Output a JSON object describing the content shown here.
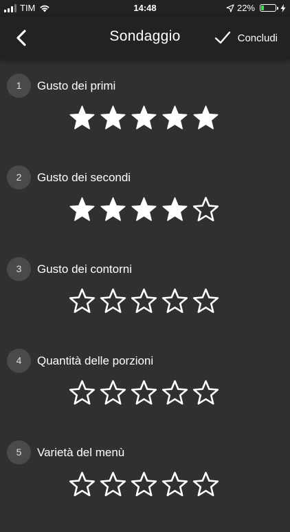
{
  "status_bar": {
    "carrier": "TIM",
    "time": "14:48",
    "battery_percent": "22%",
    "battery_level": 0.22,
    "signal_bars": 3,
    "icons": [
      "signal-icon",
      "wifi-icon",
      "location-arrow-icon",
      "battery-icon",
      "charging-bolt-icon"
    ]
  },
  "nav": {
    "title": "Sondaggio",
    "back_icon": "chevron-left-icon",
    "done_icon": "checkmark-icon",
    "done_label": "Concludi"
  },
  "colors": {
    "background": "#303030",
    "bar": "#222222",
    "badge": "#4a4a4a",
    "text": "#ffffff"
  },
  "max_rating": 5,
  "questions": [
    {
      "number": "1",
      "label": "Gusto dei primi",
      "rating": 5
    },
    {
      "number": "2",
      "label": "Gusto dei secondi",
      "rating": 4
    },
    {
      "number": "3",
      "label": "Gusto dei contorni",
      "rating": 0
    },
    {
      "number": "4",
      "label": "Quantità delle porzioni",
      "rating": 0
    },
    {
      "number": "5",
      "label": "Varietà del menù",
      "rating": 0
    }
  ]
}
